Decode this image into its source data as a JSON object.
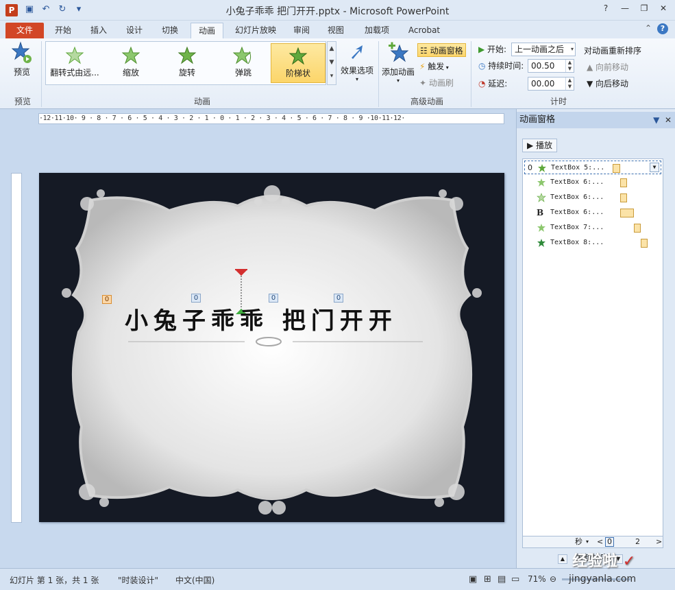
{
  "window": {
    "title": "小兔子乖乖 把门开开.pptx - Microsoft PowerPoint",
    "app_badge": "P"
  },
  "tabs": [
    "文件",
    "开始",
    "插入",
    "设计",
    "切换",
    "动画",
    "幻灯片放映",
    "审阅",
    "视图",
    "加载项",
    "Acrobat"
  ],
  "active_tab": "动画",
  "ribbon": {
    "preview": {
      "button": "预览",
      "group": "预览"
    },
    "animation_gallery": [
      "翻转式由远...",
      "缩放",
      "旋转",
      "弹跳",
      "阶梯状"
    ],
    "selected_animation": "阶梯状",
    "effect_options": "效果选项",
    "animation_group": "动画",
    "add_animation": "添加动画",
    "animation_pane_btn": "动画窗格",
    "trigger": "触发",
    "animation_painter": "动画刷",
    "advanced_group": "高级动画",
    "start_label": "开始:",
    "start_value": "上一动画之后",
    "duration_label": "持续时间:",
    "duration_value": "00.50",
    "delay_label": "延迟:",
    "delay_value": "00.00",
    "reorder_title": "对动画重新排序",
    "move_earlier": "向前移动",
    "move_later": "向后移动",
    "timing_group": "计时"
  },
  "ruler": {
    "horizontal": "·12·11·10· 9 · 8 · 7 · 6 · 5 · 4 · 3 · 2 · 1 · 0 · 1 · 2 · 3 · 4 · 5 · 6 · 7 · 8 · 9 ·10·11·12·"
  },
  "slide": {
    "title": "小兔子乖乖 把门开开",
    "tags": [
      "0",
      "0",
      "0",
      "0"
    ]
  },
  "pane": {
    "title": "动画窗格",
    "play": "播放",
    "items": [
      {
        "num": "0",
        "name": "TextBox 5:...",
        "icon": "star-effect-icon"
      },
      {
        "num": "",
        "name": "TextBox 6:...",
        "icon": "star-effect-icon"
      },
      {
        "num": "",
        "name": "TextBox 6:...",
        "icon": "sparkle-effect-icon"
      },
      {
        "num": "",
        "name": "TextBox 6:...",
        "icon": "bold-effect-icon"
      },
      {
        "num": "",
        "name": "TextBox 7:...",
        "icon": "star-effect-icon"
      },
      {
        "num": "",
        "name": "TextBox 8:...",
        "icon": "star-effect-icon"
      }
    ],
    "timeline_unit": "秒",
    "timeline_start": "0",
    "timeline_mark": "2",
    "reorder_label": "重新排序"
  },
  "status": {
    "slide_info": "幻灯片 第 1 张，共 1 张",
    "theme": "\"时装设计\"",
    "language": "中文(中国)",
    "zoom": "71%"
  },
  "watermark": {
    "text": "经验啦",
    "url": "jingyanla.com"
  },
  "colors": {
    "accent": "#d24726",
    "ribbon_highlight": "#fcd56a",
    "animation_star": "#5fa83c"
  }
}
